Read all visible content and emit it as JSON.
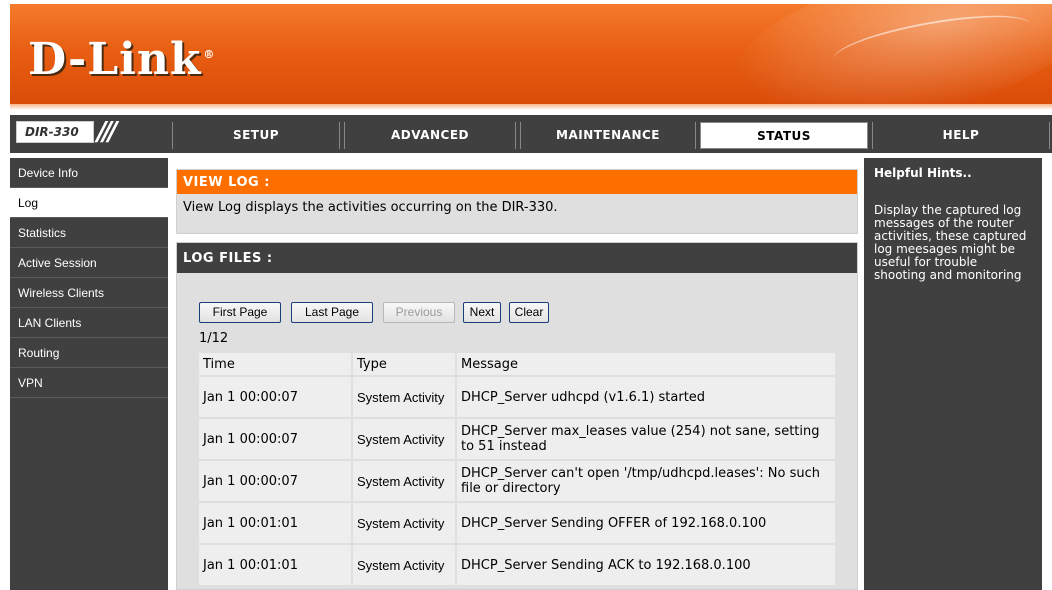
{
  "brand": {
    "logo": "D-Link",
    "reg": "®",
    "model": "DIR-330"
  },
  "nav": {
    "tabs": [
      {
        "label": "SETUP"
      },
      {
        "label": "ADVANCED"
      },
      {
        "label": "MAINTENANCE"
      },
      {
        "label": "STATUS",
        "active": true
      },
      {
        "label": "HELP"
      }
    ]
  },
  "sidebar": {
    "items": [
      {
        "label": "Device Info"
      },
      {
        "label": "Log",
        "active": true
      },
      {
        "label": "Statistics"
      },
      {
        "label": "Active Session"
      },
      {
        "label": "Wireless Clients"
      },
      {
        "label": "LAN Clients"
      },
      {
        "label": "Routing"
      },
      {
        "label": "VPN"
      }
    ]
  },
  "view_log": {
    "title": "VIEW LOG :",
    "description": "View Log displays the activities occurring on the DIR-330."
  },
  "log_files": {
    "title": "LOG FILES :",
    "buttons": {
      "first": "First Page",
      "last": "Last Page",
      "previous": "Previous",
      "next": "Next",
      "clear": "Clear"
    },
    "page": "1/12",
    "columns": {
      "time": "Time",
      "type": "Type",
      "message": "Message"
    },
    "rows": [
      {
        "time": "Jan 1 00:00:07",
        "type": "System Activity",
        "message": "DHCP_Server udhcpd (v1.6.1) started"
      },
      {
        "time": "Jan 1 00:00:07",
        "type": "System Activity",
        "message": "DHCP_Server max_leases value (254) not sane, setting to 51 instead"
      },
      {
        "time": "Jan 1 00:00:07",
        "type": "System Activity",
        "message": "DHCP_Server can't open '/tmp/udhcpd.leases': No such file or directory"
      },
      {
        "time": "Jan 1 00:01:01",
        "type": "System Activity",
        "message": "DHCP_Server Sending OFFER of 192.168.0.100"
      },
      {
        "time": "Jan 1 00:01:01",
        "type": "System Activity",
        "message": "DHCP_Server Sending ACK to 192.168.0.100"
      }
    ]
  },
  "help": {
    "title": "Helpful Hints..",
    "text": "Display the captured log messages of the router activities, these captured log meesages might be useful for trouble shooting and monitoring"
  },
  "colors": {
    "header_orange": "#ff6f00",
    "dark_panel": "#404040",
    "content_bg": "#dfdfdf"
  }
}
